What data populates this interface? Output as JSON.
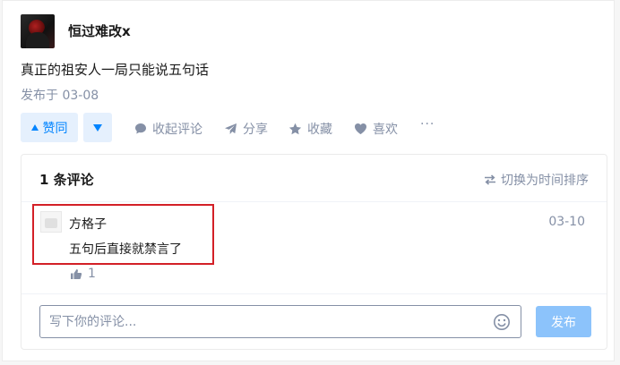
{
  "post": {
    "author": "恒过难改x",
    "content": "真正的祖安人一局只能说五句话",
    "published": "发布于 03-08"
  },
  "actions": {
    "vote_up_label": "赞同",
    "collapse_comments": "收起评论",
    "share": "分享",
    "favorite": "收藏",
    "like": "喜欢",
    "more": "···"
  },
  "comments": {
    "count_label": "1 条评论",
    "sort_label": "切换为时间排序",
    "items": [
      {
        "author": "方格子",
        "date": "03-10",
        "text": "五句后直接就禁言了",
        "likes": "1"
      }
    ],
    "input_placeholder": "写下你的评论...",
    "submit_label": "发布"
  },
  "colors": {
    "accent": "#0084ff",
    "muted": "#8590a6",
    "highlight_border": "#d32027",
    "submit_disabled": "#8cc3fb"
  }
}
